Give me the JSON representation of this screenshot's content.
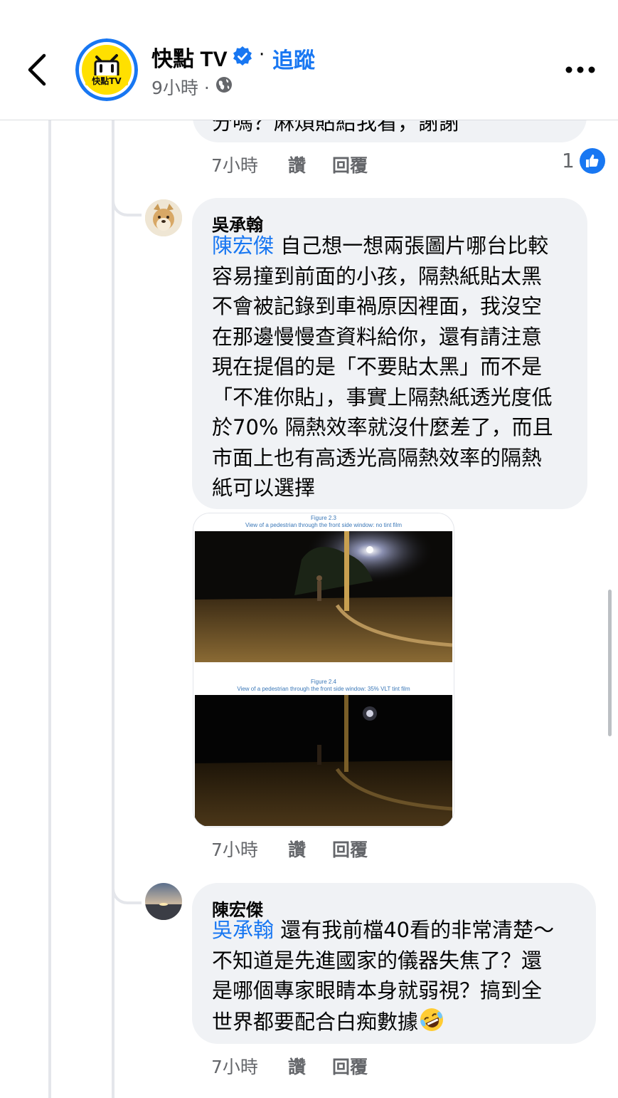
{
  "header": {
    "page_name": "快點 TV",
    "separator": "·",
    "follow": "追蹤",
    "time": "9小時 ·",
    "logo_text": "快點TV"
  },
  "top_comment": {
    "text_fragment": "分嗎？麻煩貼給我看，謝謝",
    "time": "7小時",
    "like": "讚",
    "reply": "回覆",
    "reaction_count": "1"
  },
  "comment1": {
    "author": "吳承翰",
    "mention": "陳宏傑",
    "lines": [
      " 自己想一想兩張圖片哪台比較",
      "容易撞到前面的小孩，隔熱紙貼太黑",
      "不會被記錄到車禍原因裡面，我沒空",
      "在那邊慢慢查資料給你，還有請注意",
      "現在提倡的是「不要貼太黑」而不是",
      "「不准你貼」，事實上隔熱紙透光度低",
      "於70% 隔熱效率就沒什麼差了，而且",
      "市面上也有高透光高隔熱效率的隔熱",
      "紙可以選擇"
    ],
    "image": {
      "fig1_title": "Figure 2.3",
      "fig1_caption": "View of a pedestrian through the front side window: no tint film",
      "fig2_title": "Figure 2.4",
      "fig2_caption": "View of a pedestrian through the front side window: 35% VLT tint film"
    },
    "time": "7小時",
    "like": "讚",
    "reply": "回覆"
  },
  "comment2": {
    "author": "陳宏傑",
    "mention": "吳承翰",
    "lines": [
      " 還有我前檔40看的非常清楚～",
      "不知道是先進國家的儀器失焦了？還",
      "是哪個專家眼睛本身就弱視？搞到全",
      "世界都要配合白痴數據"
    ],
    "emoji": "rolling-on-floor-laughing",
    "time": "7小時",
    "like": "讚",
    "reply": "回覆"
  },
  "colors": {
    "accent": "#1877f2",
    "bubble": "#f0f2f5",
    "secondary_text": "#65676b",
    "thread_line": "#e4e6eb"
  }
}
